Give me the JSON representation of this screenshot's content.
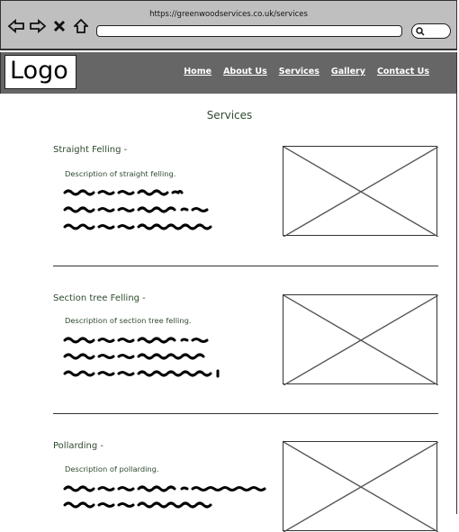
{
  "browser": {
    "url": "https://greenwoodservices.co.uk/services",
    "icons": [
      "back-icon",
      "forward-icon",
      "close-icon",
      "home-icon",
      "search-icon"
    ]
  },
  "header": {
    "logo": "Logo",
    "nav": [
      "Home",
      "About Us",
      "Services",
      "Gallery",
      "Contact Us"
    ]
  },
  "main": {
    "title": "Services",
    "services": [
      {
        "title": "Straight Felling -",
        "description": "Description of straight felling."
      },
      {
        "title": "Section tree Felling -",
        "description": "Description of section tree felling."
      },
      {
        "title": "Pollarding -",
        "description": "Description of pollarding."
      }
    ]
  },
  "colors": {
    "chrome": "#bfbfbf",
    "header": "#666666",
    "accent_text": "#2e4a2e"
  }
}
